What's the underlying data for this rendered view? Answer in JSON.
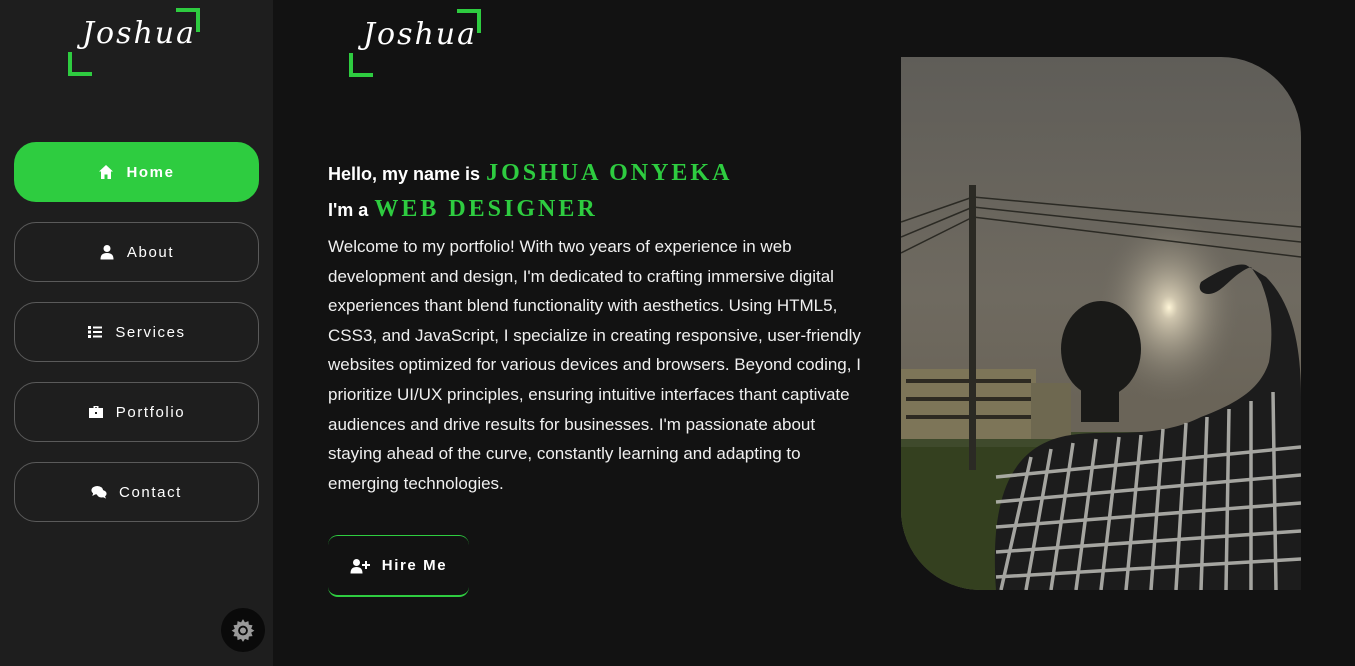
{
  "brand": {
    "logo_text": "Joshua"
  },
  "sidebar": {
    "items": [
      {
        "label": "Home",
        "icon": "home-icon",
        "active": true
      },
      {
        "label": "About",
        "icon": "user-icon",
        "active": false
      },
      {
        "label": "Services",
        "icon": "list-icon",
        "active": false
      },
      {
        "label": "Portfolio",
        "icon": "briefcase-icon",
        "active": false
      },
      {
        "label": "Contact",
        "icon": "comments-icon",
        "active": false
      }
    ],
    "theme_toggle_icon": "gear-icon"
  },
  "hero": {
    "greeting": "Hello, my name is",
    "name": "JOSHUA ONYEKA",
    "role_prefix": "I'm a",
    "role": "WEB DESIGNER",
    "bio": "Welcome to my portfolio! With two years of experience in web development and design, I'm dedicated to crafting immersive digital experiences thant blend functionality with aesthetics. Using HTML5, CSS3, and JavaScript, I specialize in creating responsive, user-friendly websites optimized for various devices and browsers. Beyond coding, I prioritize UI/UX principles, ensuring intuitive interfaces thant captivate audiences and drive results for businesses. I'm passionate about staying ahead of the curve, constantly learning and adapting to emerging technologies.",
    "hire_button": "Hire Me",
    "hire_icon": "user-plus-icon"
  },
  "colors": {
    "accent": "#2ecc40",
    "sidebar_bg": "#1e1e1e",
    "page_bg": "#121212"
  }
}
